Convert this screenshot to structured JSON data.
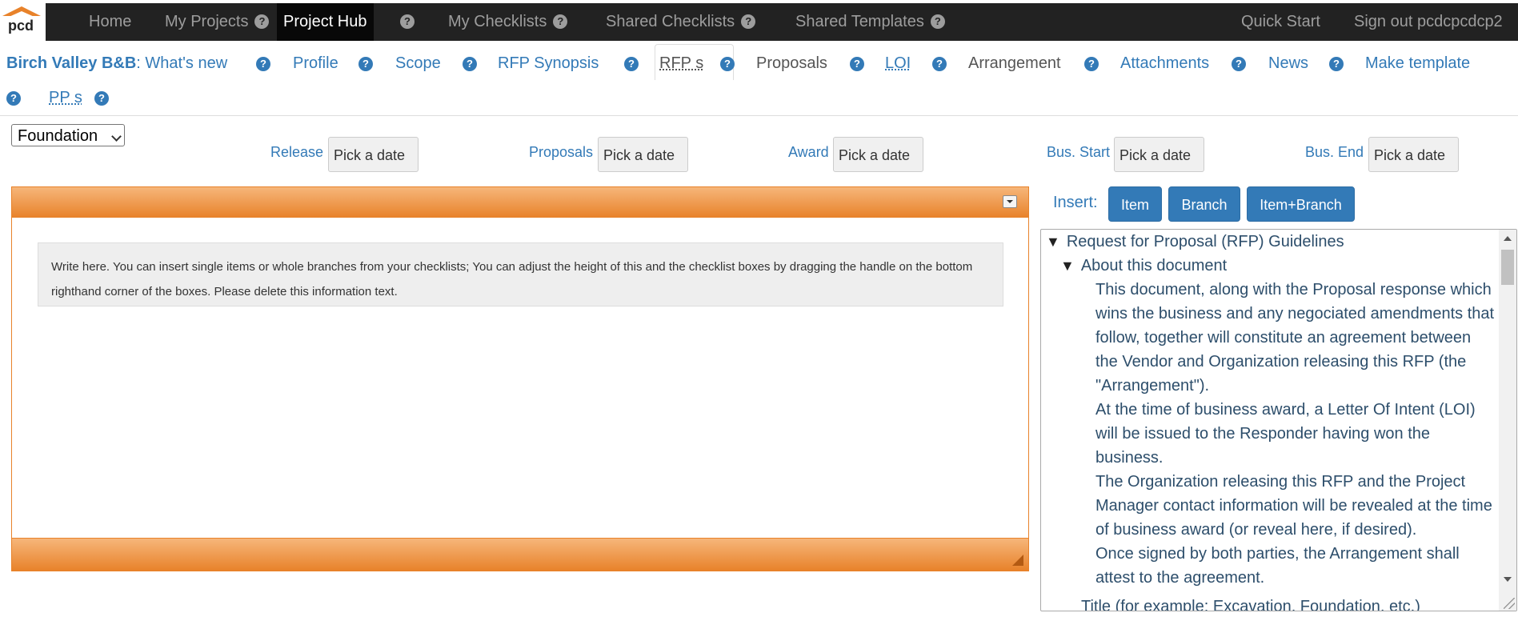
{
  "topnav": {
    "logo_text": "pcd",
    "items": [
      {
        "label": "Home",
        "help": false
      },
      {
        "label": "My Projects",
        "help": true
      },
      {
        "label": "Project Hub",
        "help": true,
        "active": true
      },
      {
        "label": "My Checklists",
        "help": true
      },
      {
        "label": "Shared Checklists",
        "help": true
      },
      {
        "label": "Shared Templates",
        "help": true
      }
    ],
    "quick_start": "Quick Start",
    "sign_out": "Sign out pcdcpcdcp2"
  },
  "subnav": {
    "project_name": "Birch Valley B&B",
    "whats_new": ": What's new",
    "profile": "Profile",
    "scope": "Scope",
    "rfp_synopsis": "RFP Synopsis",
    "rfps": "RFP s",
    "proposals": "Proposals",
    "loi": "LOI",
    "arrangement": "Arrangement",
    "attachments": "Attachments",
    "news": "News",
    "make_template": "Make template",
    "pps": "PP s"
  },
  "help_glyph": "?",
  "dates": {
    "select_value": "Foundation",
    "placeholder": "Pick a date",
    "release_label": "Release",
    "proposals_label": "Proposals",
    "award_label": "Award",
    "bus_start_label": "Bus. Start",
    "bus_end_label": "Bus. End"
  },
  "editor": {
    "info_text": "Write here. You can insert single items or whole branches from your checklists; You can adjust the height of this and the checklist boxes by dragging the handle on the bottom righthand corner of the boxes. Please delete this information text."
  },
  "insert": {
    "label": "Insert:",
    "item": "Item",
    "branch": "Branch",
    "item_branch": "Item+Branch"
  },
  "tree": {
    "root": "Request for Proposal (RFP) Guidelines",
    "child": "About this document",
    "paragraphs": [
      "This document, along with the Proposal response which wins the business and any negociated amendments that follow, together will constitute an agreement between the Vendor and Organization releasing this RFP (the \"Arrangement\").",
      "At the time of business award, a Letter Of Intent (LOI) will be issued to the Responder having won the business.",
      "The Organization releasing this RFP and the Project Manager contact information will be revealed at the time of business award (or reveal here, if desired).",
      "Once signed by both parties, the Arrangement shall attest to the agreement."
    ],
    "next_item": "Title (for example: Excavation, Foundation, etc.)"
  },
  "colors": {
    "accent": "#e8822a",
    "link": "#337ab7",
    "nav_bg": "#222222"
  }
}
